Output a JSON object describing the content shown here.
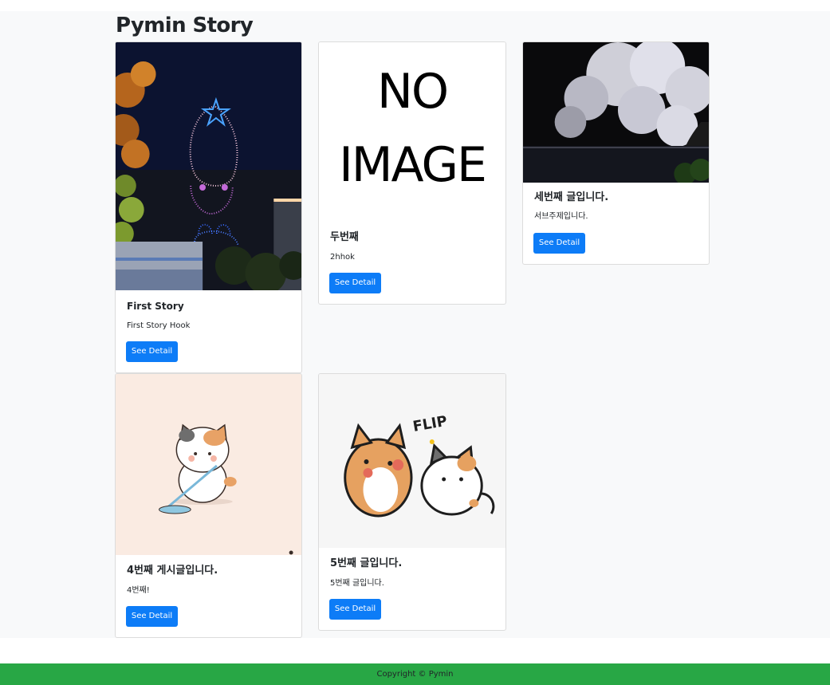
{
  "page": {
    "title": "Pymin Story"
  },
  "cards": [
    {
      "title": "First Story",
      "hook": "First Story Hook",
      "button": "See Detail",
      "image": "night-drone-show-photo"
    },
    {
      "title": "두번째",
      "hook": "2hhok",
      "button": "See Detail",
      "image": "no-image-placeholder",
      "image_text_line1": "NO",
      "image_text_line2": "IMAGE"
    },
    {
      "title": "세번째 글입니다.",
      "hook": "서브주제입니다.",
      "button": "See Detail",
      "image": "night-cherry-blossom-photo"
    },
    {
      "title": "4번째 게시글입니다.",
      "hook": "4번째!",
      "button": "See Detail",
      "image": "cat-mopping-illustration"
    },
    {
      "title": "5번째 글입니다.",
      "hook": "5번째 글입니다.",
      "button": "See Detail",
      "image": "dog-cat-flip-illustration",
      "image_caption": "FLIP"
    }
  ],
  "footer": {
    "text": "Copyright © Pymin"
  },
  "colors": {
    "button": "#0d7cf7",
    "footer": "#28a745",
    "background": "#f8f9fa"
  }
}
